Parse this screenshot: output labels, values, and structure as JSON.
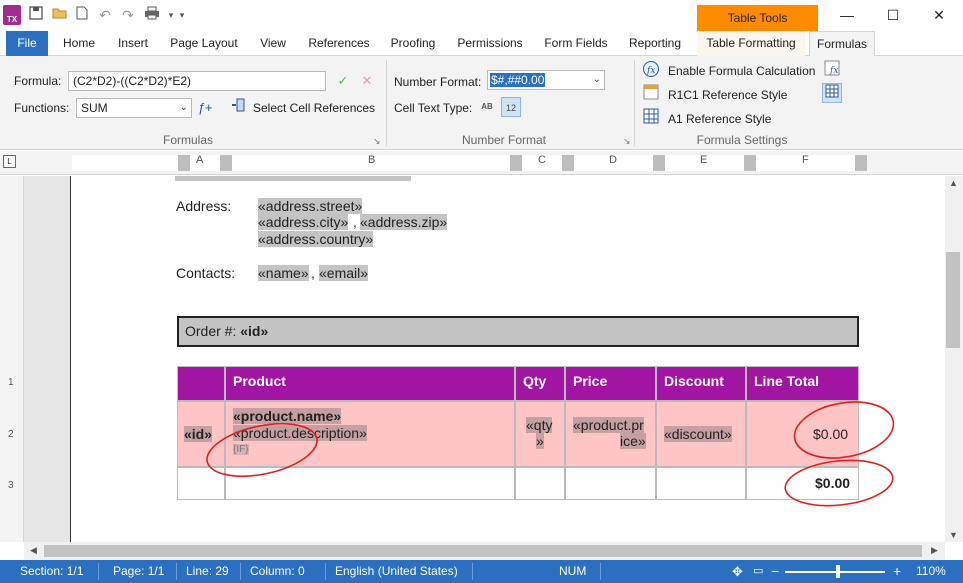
{
  "titlebar": {
    "context_tab": "Table Tools",
    "minimize": "—",
    "maximize": "☐",
    "close": "✕"
  },
  "tabs": [
    "File",
    "Home",
    "Insert",
    "Page Layout",
    "View",
    "References",
    "Proofing",
    "Permissions",
    "Form Fields",
    "Reporting",
    "Table Formatting",
    "Formulas"
  ],
  "ribbon": {
    "formula_label": "Formula:",
    "formula_value": "(C2*D2)-((C2*D2)*E2)",
    "functions_label": "Functions:",
    "functions_value": "SUM",
    "select_cell_refs": "Select Cell References",
    "formulas_group": "Formulas",
    "number_format_label": "Number Format:",
    "number_format_value": "$#,##0.00",
    "cell_text_type_label": "Cell Text Type:",
    "cell_text_ab": "AB",
    "cell_text_12": "12",
    "number_format_group": "Number Format",
    "enable_formula": "Enable Formula Calculation",
    "r1c1": "R1C1 Reference Style",
    "a1": "A1 Reference Style",
    "formula_settings_group": "Formula Settings"
  },
  "ruler": {
    "columns": [
      "A",
      "B",
      "C",
      "D",
      "E",
      "F"
    ],
    "rows": [
      "1",
      "2",
      "3"
    ]
  },
  "document": {
    "address_label": "Address:",
    "address_street": "«address.street»",
    "address_city": "«address.city»",
    "address_comma": ",",
    "address_zip": "«address.zip»",
    "address_country": "«address.country»",
    "contacts_label": "Contacts:",
    "contact_name": "«name»",
    "contact_comma": ",",
    "contact_email": "«email»",
    "order_label": "Order #:",
    "order_id": "«id»",
    "table": {
      "headers": [
        "",
        "Product",
        "Qty",
        "Price",
        "Discount",
        "Line Total"
      ],
      "row_id": "«id»",
      "product_name": "«product.name»",
      "product_description": "«product.description»",
      "if_field": "{IF}",
      "qty_1": "«qty",
      "qty_2": "»",
      "price_1": "«product.pr",
      "price_2": "ice»",
      "discount": "«discount»",
      "line_total": "$0.00",
      "grand_total": "$0.00"
    }
  },
  "status": {
    "section": "Section: 1/1",
    "page": "Page: 1/1",
    "line": "Line: 29",
    "column": "Column: 0",
    "language": "English (United States)",
    "num": "NUM",
    "zoom": "110%",
    "zoom_level_percent": 110
  },
  "colors": {
    "accent": "#2b6fc0",
    "table_header": "#a214a2",
    "row_pink": "#ffc5c5",
    "context_tab": "#ff8c00",
    "annotation": "#e02020"
  }
}
